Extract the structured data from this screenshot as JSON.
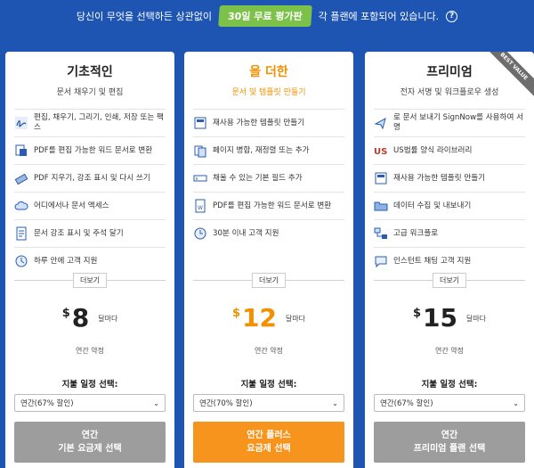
{
  "banner": {
    "pre": "당신이 무엇을 선택하든 상관없이",
    "trial": "30일 무료 평가판",
    "post": "각 플랜에 포함되어 있습니다.",
    "help_icon": "?"
  },
  "colors": {
    "background": "#1e55b3",
    "accent": "#f7941d",
    "trial_badge": "#7cc24a",
    "button_gray": "#9d9d9d"
  },
  "plans": [
    {
      "title": "기초적인",
      "subtitle": "문서 채우기 및 편집",
      "features": [
        {
          "icon": "signature-icon",
          "text": "편집, 채우기, 그리기, 인쇄, 저장 또는 팩스"
        },
        {
          "icon": "convert-doc-icon",
          "text": "PDF를 편집 가능한 워드 문서로 변환"
        },
        {
          "icon": "eraser-icon",
          "text": "PDF 지우기, 강조 표시 및 다시 쓰기"
        },
        {
          "icon": "cloud-icon",
          "text": "어디에서나 문서 액세스"
        },
        {
          "icon": "document-icon",
          "text": "문서 강조 표시 및 주석 달기"
        },
        {
          "icon": "clock-icon",
          "text": "하루 안에 고객 지원"
        }
      ],
      "more": "더보기",
      "currency": "$",
      "price": "8",
      "per": "달마다",
      "annual": "연간 약정",
      "schedule_label": "지불 일정 선택:",
      "select_value": "연간(67% 할인)",
      "cta_line1": "연간",
      "cta_line2": "기본 요금제 선택"
    },
    {
      "title": "을 더한",
      "subtitle": "문서 및 템플릿 만들기",
      "features": [
        {
          "icon": "template-icon",
          "text": "재사용 가능한 템플릿 만들기"
        },
        {
          "icon": "merge-pages-icon",
          "text": "페이지 병합, 재정렬 또는 추가"
        },
        {
          "icon": "fillable-field-icon",
          "text": "채울 수 있는 기본 필드 추가"
        },
        {
          "icon": "word-doc-icon",
          "text": "PDF를 편집 가능한 워드 문서로 변환"
        },
        {
          "icon": "support-timer-icon",
          "text": "30분 이내 고객 지원"
        }
      ],
      "more": "더보기",
      "currency": "$",
      "price": "12",
      "per": "달마다",
      "annual": "연간 약정",
      "schedule_label": "지불 일정 선택:",
      "select_value": "연간(70% 할인)",
      "cta_line1": "연간 플러스",
      "cta_line2": "요금제 선택"
    },
    {
      "title": "프리미엄",
      "subtitle": "전자 서명 및 워크플로우 생성",
      "ribbon": "BEST VALUE",
      "features": [
        {
          "icon": "signnow-icon",
          "text": "로 문서 보내기 SignNow를 사용하여 서명"
        },
        {
          "icon": "us-forms-icon",
          "text": "US법률 양식 라이브러리"
        },
        {
          "icon": "template-icon",
          "text": "재사용 가능한 템플릿 만들기"
        },
        {
          "icon": "folder-icon",
          "text": "데이터 수집 및 내보내기"
        },
        {
          "icon": "workflow-icon",
          "text": "고급 워크플로"
        },
        {
          "icon": "chat-icon",
          "text": "인스턴트 채팅 고객 지원"
        }
      ],
      "more": "더보기",
      "currency": "$",
      "price": "15",
      "per": "달마다",
      "annual": "연간 약정",
      "schedule_label": "지불 일정 선택:",
      "select_value": "연간(67% 할인)",
      "cta_line1": "연간",
      "cta_line2": "프리미엄 플랜 선택"
    }
  ]
}
